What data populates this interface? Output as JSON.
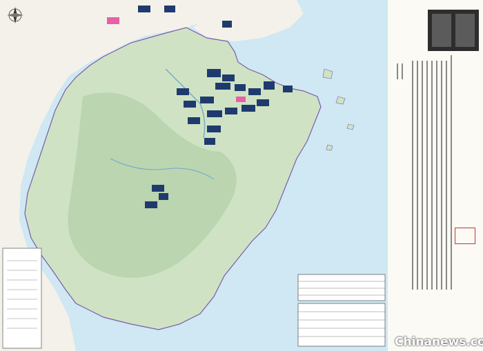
{
  "title": "",
  "preface_label": "",
  "seal_text": "",
  "watermark_cn": "",
  "watermark_en": "Chinanews.com",
  "colors": {
    "sea": "#cfe8f3",
    "land": "#cfe3c4",
    "mountain": "#9fc49a",
    "border": "#7a5ca8",
    "marker": "#1f3b6e",
    "marker_pink": "#e85fa5",
    "watermark": "#d62b1f"
  },
  "icons": {
    "compass": "compass-rose-icon"
  }
}
